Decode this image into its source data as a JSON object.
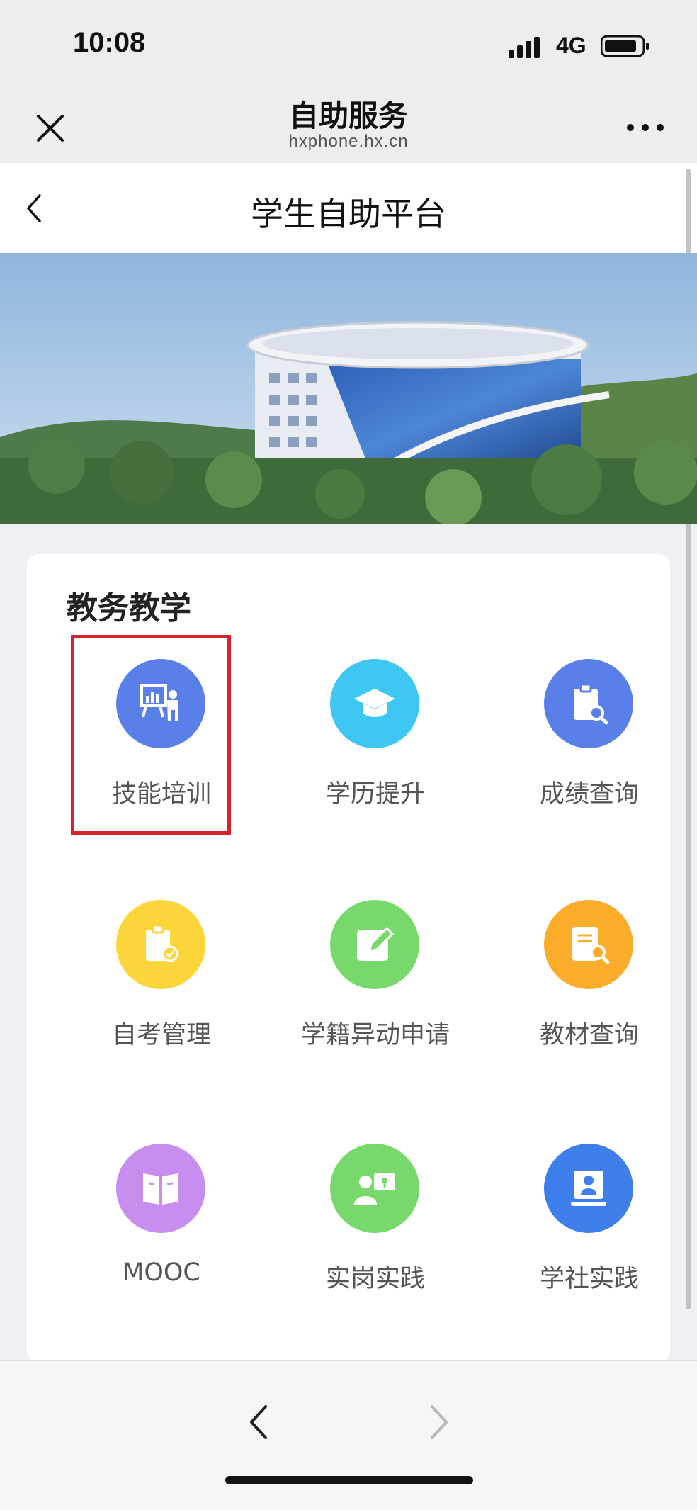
{
  "status_bar": {
    "time": "10:08",
    "network": "4G",
    "icons": [
      "signal-icon",
      "battery-icon"
    ]
  },
  "webview_nav": {
    "title": "自助服务",
    "subtitle": "hxphone.hx.cn",
    "icons": [
      "close-icon",
      "more-icon"
    ]
  },
  "page_header": {
    "title": "学生自助平台",
    "icons": [
      "back-icon"
    ]
  },
  "banner": {
    "image": "campus-building-photo"
  },
  "section": {
    "title": "教务教学",
    "items": [
      {
        "label": "技能培训",
        "icon": "presentation-icon",
        "color": "#5b7fe8",
        "highlighted": true
      },
      {
        "label": "学历提升",
        "icon": "graduation-cap-icon",
        "color": "#3ec7f2"
      },
      {
        "label": "成绩查询",
        "icon": "clipboard-search-icon",
        "color": "#5b7fe8"
      },
      {
        "label": "自考管理",
        "icon": "clipboard-check-icon",
        "color": "#fbd53a"
      },
      {
        "label": "学籍异动申请",
        "icon": "edit-icon",
        "color": "#77d86c"
      },
      {
        "label": "教材查询",
        "icon": "book-search-icon",
        "color": "#fbac2b"
      },
      {
        "label": "MOOC",
        "icon": "open-book-icon",
        "color": "#c78ef0"
      },
      {
        "label": "实岗实践",
        "icon": "teacher-screen-icon",
        "color": "#77d86c"
      },
      {
        "label": "学社实践",
        "icon": "id-badge-icon",
        "color": "#3f7fec"
      }
    ]
  },
  "bottom_bar": {
    "icons": [
      "back-arrow-icon",
      "forward-arrow-icon"
    ]
  },
  "colors": {
    "highlight": "#d9232a",
    "label_text": "#555555"
  }
}
